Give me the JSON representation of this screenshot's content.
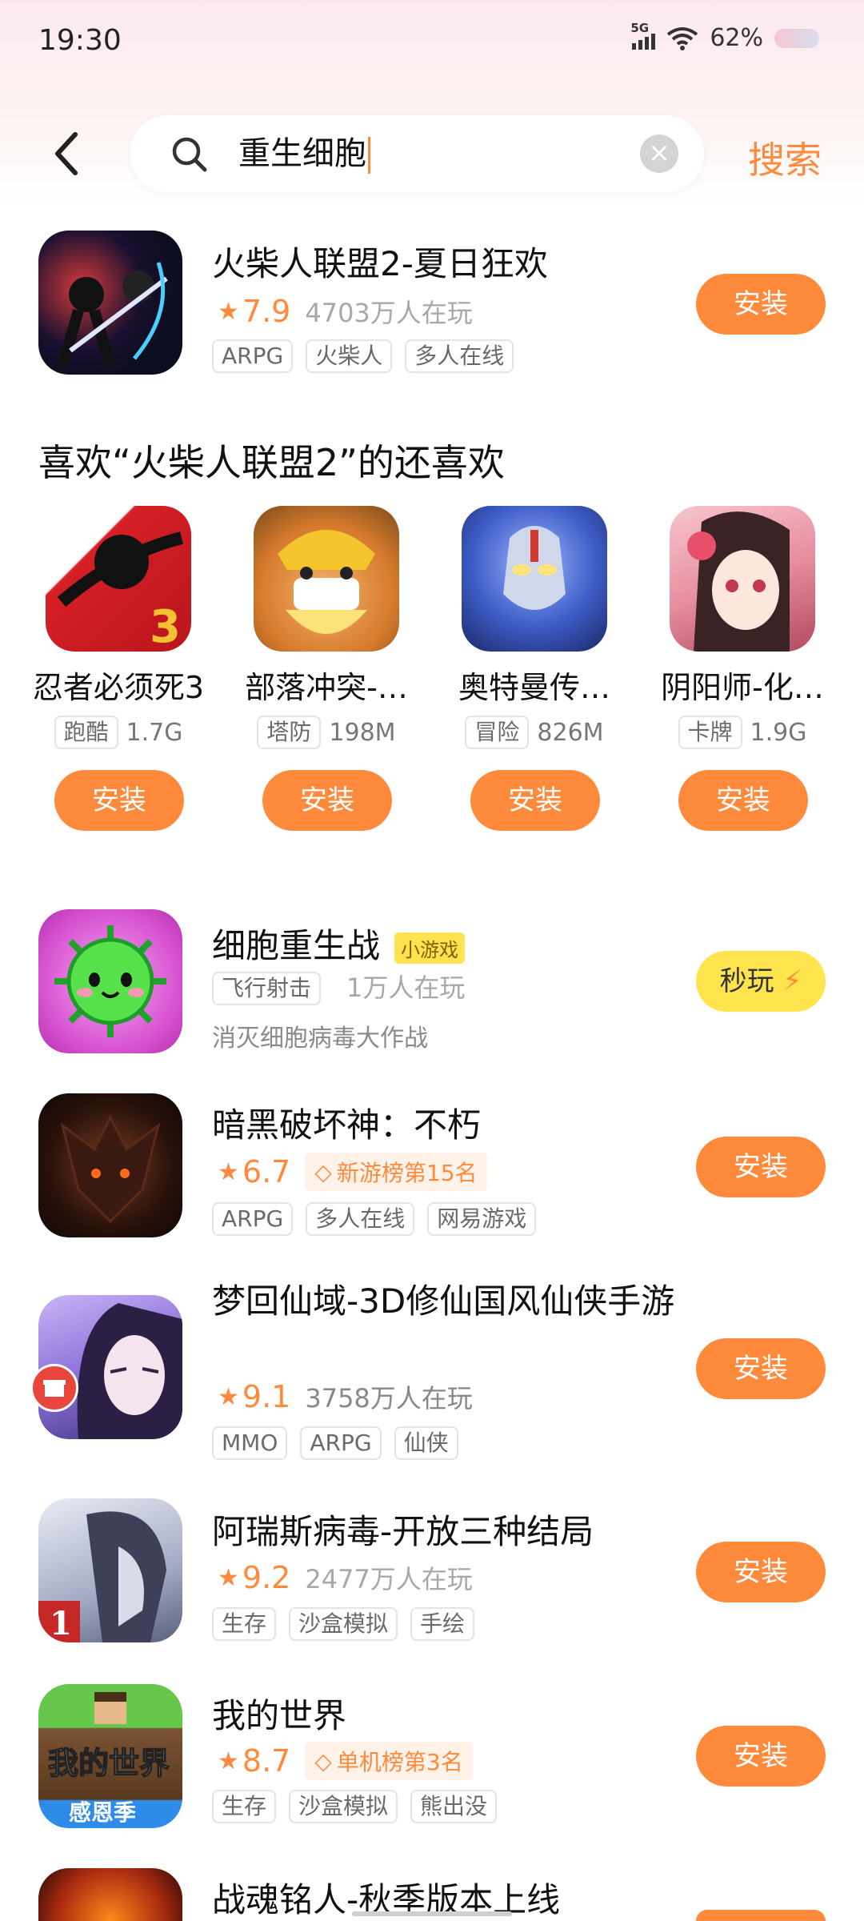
{
  "status_bar": {
    "time": "19:30",
    "network": "5G",
    "battery": "62%"
  },
  "search": {
    "query": "重生细胞",
    "action_label": "搜索"
  },
  "featured": {
    "title": "火柴人联盟2-夏日狂欢",
    "score": "7.9",
    "players": "4703万人在玩",
    "tags": [
      "ARPG",
      "火柴人",
      "多人在线"
    ],
    "install_label": "安装"
  },
  "recommendations": {
    "title": "喜欢“火柴人联盟2”的还喜欢",
    "items": [
      {
        "name": "忍者必须死3",
        "tag": "跑酷",
        "size": "1.7G",
        "install_label": "安装"
      },
      {
        "name": "部落冲突-…",
        "tag": "塔防",
        "size": "198M",
        "install_label": "安装"
      },
      {
        "name": "奥特曼传…",
        "tag": "冒险",
        "size": "826M",
        "install_label": "安装"
      },
      {
        "name": "阴阳师-化…",
        "tag": "卡牌",
        "size": "1.9G",
        "install_label": "安装"
      }
    ]
  },
  "results": [
    {
      "title": "细胞重生战",
      "badge": "小游戏",
      "tags": [
        "飞行射击"
      ],
      "players": "1万人在玩",
      "description": "消灭细胞病毒大作战",
      "action_label": "秒玩"
    },
    {
      "title": "暗黑破坏神：不朽",
      "score": "6.7",
      "rank": "新游榜第15名",
      "tags": [
        "ARPG",
        "多人在线",
        "网易游戏"
      ],
      "install_label": "安装"
    },
    {
      "title": "梦回仙域-3D修仙国风仙侠手游",
      "score": "9.1",
      "players": "3758万人在玩",
      "tags": [
        "MMO",
        "ARPG",
        "仙侠"
      ],
      "install_label": "安装"
    },
    {
      "title": "阿瑞斯病毒-开放三种结局",
      "score": "9.2",
      "players": "2477万人在玩",
      "tags": [
        "生存",
        "沙盒模拟",
        "手绘"
      ],
      "install_label": "安装",
      "icon_badge": "1"
    },
    {
      "title": "我的世界",
      "score": "8.7",
      "rank": "单机榜第3名",
      "tags": [
        "生存",
        "沙盒模拟",
        "熊出没"
      ],
      "install_label": "安装",
      "icon_text": "我的世界",
      "icon_subtext": "感恩季"
    },
    {
      "title": "战魂铭人-秋季版本上线"
    }
  ]
}
